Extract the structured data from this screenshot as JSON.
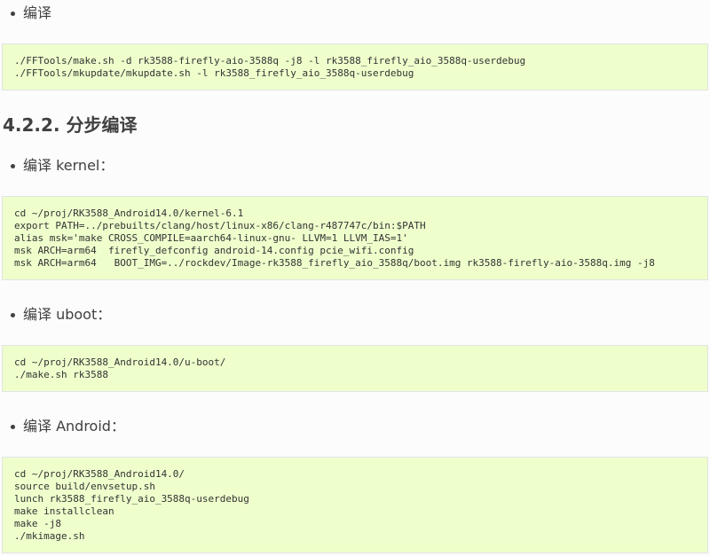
{
  "sections": {
    "build_all_label": "编译",
    "build_all_code": [
      "./FFTools/make.sh -d rk3588-firefly-aio-3588q -j8 -l rk3588_firefly_aio_3588q-userdebug",
      "./FFTools/mkupdate/mkupdate.sh -l rk3588_firefly_aio_3588q-userdebug"
    ],
    "step_heading": "4.2.2. 分步编译",
    "kernel_label": "编译 kernel：",
    "kernel_code": [
      "cd ~/proj/RK3588_Android14.0/kernel-6.1",
      "export PATH=../prebuilts/clang/host/linux-x86/clang-r487747c/bin:$PATH",
      "alias msk='make CROSS_COMPILE=aarch64-linux-gnu- LLVM=1 LLVM_IAS=1'",
      "msk ARCH=arm64  firefly_defconfig android-14.config pcie_wifi.config",
      "msk ARCH=arm64   BOOT_IMG=../rockdev/Image-rk3588_firefly_aio_3588q/boot.img rk3588-firefly-aio-3588q.img -j8"
    ],
    "uboot_label": "编译 uboot：",
    "uboot_code": [
      "cd ~/proj/RK3588_Android14.0/u-boot/",
      "./make.sh rk3588"
    ],
    "android_label": "编译 Android：",
    "android_code": [
      "cd ~/proj/RK3588_Android14.0/",
      "source build/envsetup.sh",
      "lunch rk3588_firefly_aio_3588q-userdebug",
      "make installclean",
      "make -j8",
      "./mkimage.sh"
    ]
  }
}
